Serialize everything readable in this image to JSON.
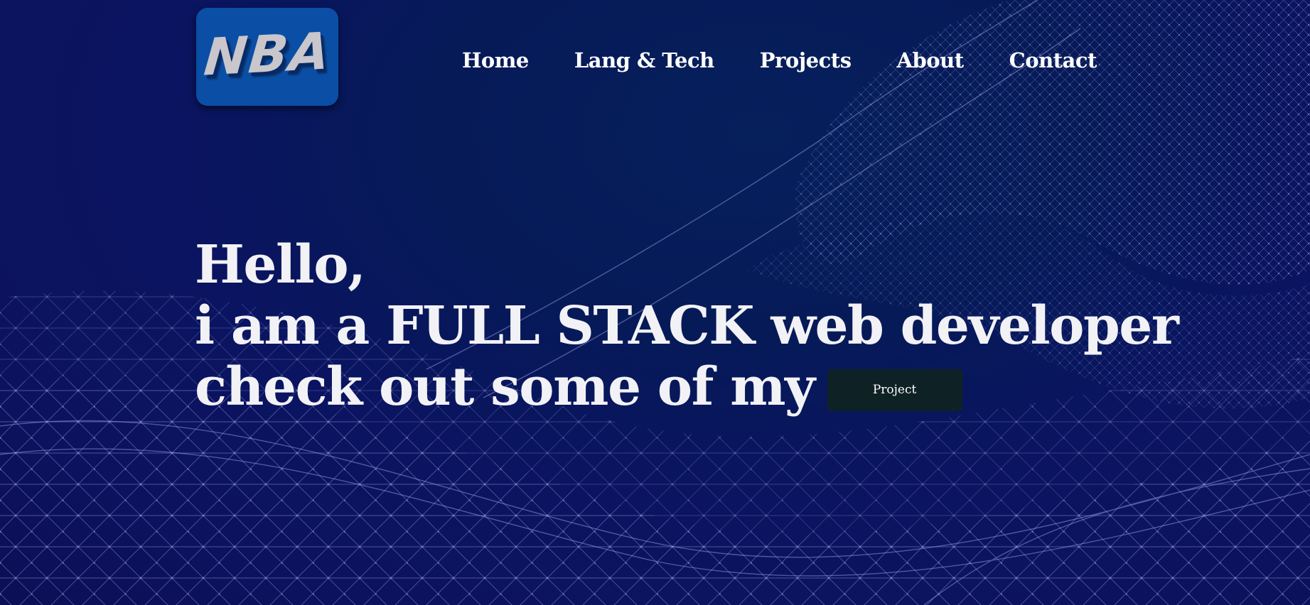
{
  "logo": {
    "text": "NBA"
  },
  "nav": {
    "items": [
      {
        "label": "Home"
      },
      {
        "label": "Lang & Tech"
      },
      {
        "label": "Projects"
      },
      {
        "label": "About"
      },
      {
        "label": "Contact"
      }
    ]
  },
  "hero": {
    "line1": "Hello,",
    "line2": "i am a FULL STACK web developer",
    "line3": "check out some of my",
    "button_label": "Project"
  },
  "colors": {
    "background": "#0b1460",
    "logo_background": "#0b4ea5",
    "button_background": "#0e2226",
    "mesh": "#8f8fe0"
  }
}
